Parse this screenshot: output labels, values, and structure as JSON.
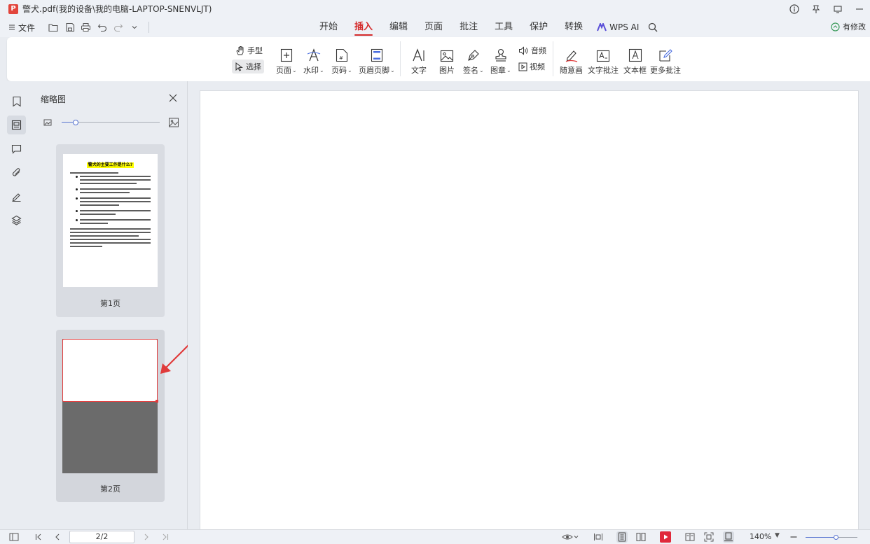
{
  "window": {
    "title": "警犬.pdf(我的设备\\我的电脑-LAPTOP-SNENVLJT)"
  },
  "menubar": {
    "file_label": "文件",
    "tabs": [
      "开始",
      "插入",
      "编辑",
      "页面",
      "批注",
      "工具",
      "保护",
      "转换"
    ],
    "active_tab": "插入",
    "wps_ai_label": "WPS AI",
    "modify_label": "有修改"
  },
  "ribbon": {
    "hand_label": "手型",
    "select_label": "选择",
    "page_label": "页面",
    "watermark_label": "水印",
    "page_number_label": "页码",
    "header_footer_label": "页眉页脚",
    "text_label": "文字",
    "image_label": "图片",
    "signature_label": "签名",
    "stamp_label": "图章",
    "audio_label": "音频",
    "video_label": "视频",
    "freehand_label": "随意画",
    "text_annotation_label": "文字批注",
    "textbox_label": "文本框",
    "more_annotation_label": "更多批注"
  },
  "thumbnail_panel": {
    "title": "缩略图",
    "page1_heading": "警犬的主要工作是什么?",
    "page1_label": "第1页",
    "page2_label": "第2页"
  },
  "statusbar": {
    "page_indicator": "2/2",
    "zoom_level": "140%"
  },
  "colors": {
    "accent": "#d42a2a",
    "highlight_yellow": "#ffff00",
    "selection_red": "#e03b3b",
    "slider_blue": "#5673d0"
  }
}
